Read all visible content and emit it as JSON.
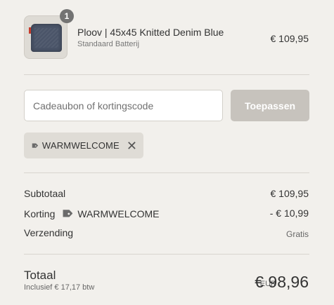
{
  "product": {
    "quantity_badge": "1",
    "name": "Ploov | 45x45 Knitted Denim Blue",
    "variant": "Standaard Batterij",
    "price": "€ 109,95"
  },
  "discount": {
    "placeholder": "Cadeaubon of kortingscode",
    "value": "",
    "apply_label": "Toepassen",
    "applied_code": "WARMWELCOME",
    "remove_icon": "close-icon"
  },
  "summary": {
    "subtotal_label": "Subtotaal",
    "subtotal_value": "€ 109,95",
    "discount_label": "Korting",
    "discount_code": "WARMWELCOME",
    "discount_value": "- € 10,99",
    "shipping_label": "Verzending",
    "shipping_value": "Gratis"
  },
  "total": {
    "label": "Totaal",
    "tax_note": "Inclusief € 17,17 btw",
    "currency": "EUR",
    "value": "€ 98,96"
  },
  "colors": {
    "background": "#f2f0ec",
    "apply_button": "#c7c3bd",
    "chip_background": "#dfdcd6",
    "tag_icon": "#6b6b6b"
  }
}
